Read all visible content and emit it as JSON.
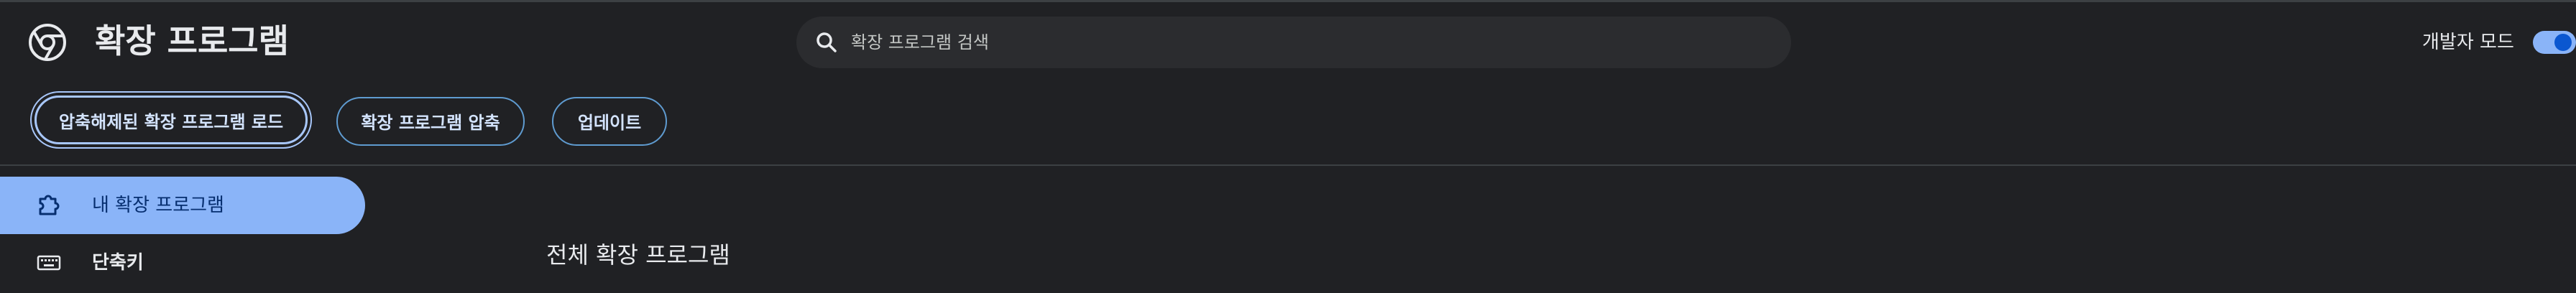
{
  "header": {
    "title": "확장 프로그램",
    "search_placeholder": "확장 프로그램 검색",
    "dev_mode_label": "개발자 모드",
    "dev_mode_on": true
  },
  "toolbar": {
    "load_unpacked_label": "압축해제된 확장 프로그램 로드",
    "pack_label": "확장 프로그램 압축",
    "update_label": "업데이트"
  },
  "sidebar": {
    "items": [
      {
        "label": "내 확장 프로그램",
        "icon": "extension-icon",
        "active": true
      },
      {
        "label": "단축키",
        "icon": "keyboard-icon",
        "active": false
      }
    ]
  },
  "main": {
    "section_title": "전체 확장 프로그램"
  },
  "colors": {
    "background": "#202124",
    "accent": "#8ab4f8",
    "button_border": "#5f9bd0"
  }
}
